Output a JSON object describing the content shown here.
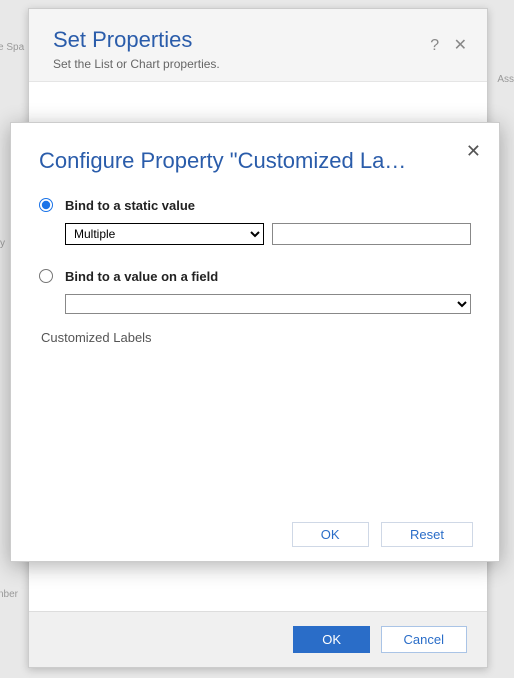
{
  "background": {
    "spa_text": "e Spa",
    "ass_text": "Ass",
    "y_text": "y",
    "nber_text": "nber"
  },
  "back_dialog": {
    "title": "Set Properties",
    "subtitle": "Set the List or Chart properties.",
    "help_icon": "?",
    "close_icon": "✕",
    "footer": {
      "ok": "OK",
      "cancel": "Cancel"
    }
  },
  "front_dialog": {
    "title": "Configure Property \"Customized La…",
    "close_icon": "✕",
    "static_bind": {
      "label": "Bind to a static value",
      "select_value": "Multiple",
      "options": [
        "Multiple"
      ],
      "text_value": ""
    },
    "field_bind": {
      "label": "Bind to a value on a field",
      "select_value": "",
      "options": [
        ""
      ]
    },
    "caption": "Customized Labels",
    "footer": {
      "ok": "OK",
      "reset": "Reset"
    }
  }
}
